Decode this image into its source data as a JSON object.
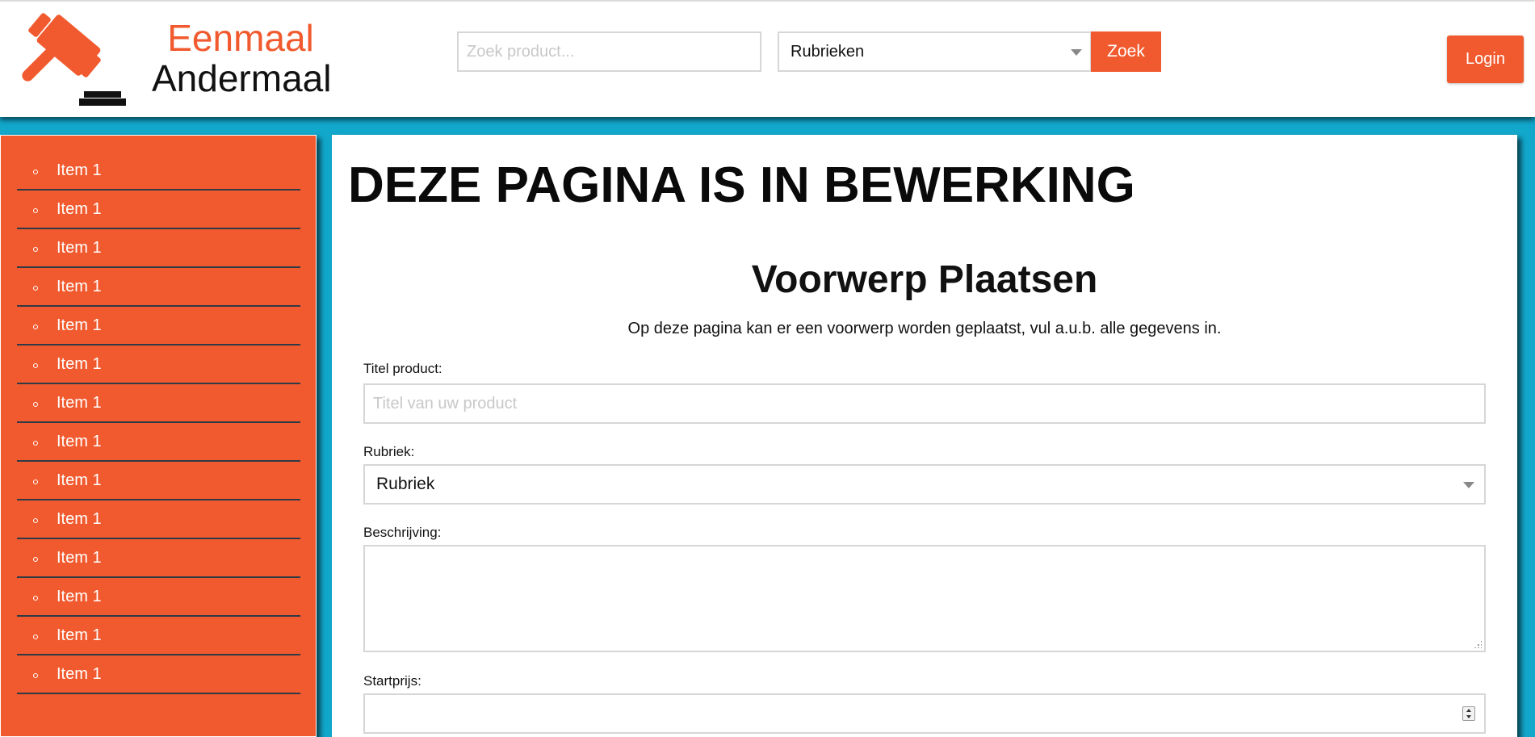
{
  "brand": {
    "line1": "Eenmaal",
    "line2": "Andermaal",
    "accent_color": "#f15a2e",
    "icon": "gavel-icon"
  },
  "header": {
    "search_placeholder": "Zoek product...",
    "category_select_value": "Rubrieken",
    "search_button_label": "Zoek",
    "login_button_label": "Login"
  },
  "sidebar": {
    "bullet_icon": "circle-bullet-icon",
    "items": [
      {
        "label": "Item 1"
      },
      {
        "label": "Item 1"
      },
      {
        "label": "Item 1"
      },
      {
        "label": "Item 1"
      },
      {
        "label": "Item 1"
      },
      {
        "label": "Item 1"
      },
      {
        "label": "Item 1"
      },
      {
        "label": "Item 1"
      },
      {
        "label": "Item 1"
      },
      {
        "label": "Item 1"
      },
      {
        "label": "Item 1"
      },
      {
        "label": "Item 1"
      },
      {
        "label": "Item 1"
      },
      {
        "label": "Item 1"
      }
    ]
  },
  "main": {
    "banner": "DEZE PAGINA IS IN BEWERKING",
    "title": "Voorwerp Plaatsen",
    "intro": "Op deze pagina kan er een voorwerp worden geplaatst, vul a.u.b. alle gegevens in.",
    "form": {
      "title_label": "Titel product:",
      "title_placeholder": "Titel van uw product",
      "title_value": "",
      "category_label": "Rubriek:",
      "category_value": "Rubriek",
      "description_label": "Beschrijving:",
      "description_value": "",
      "start_price_label": "Startprijs:",
      "start_price_value": ""
    }
  },
  "colors": {
    "background": "#12a8cc",
    "sidebar": "#f15a2e",
    "sidebar_divider": "#2f3a46",
    "button": "#f15a2e"
  }
}
